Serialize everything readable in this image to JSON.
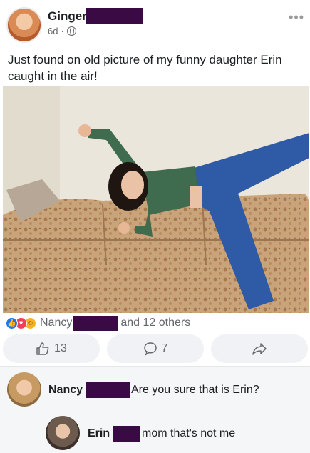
{
  "post": {
    "author_name": "Ginger",
    "time": "6d",
    "separator": "·",
    "more_label": "•••",
    "text": "Just found on old picture of my funny daughter Erin caught in the air!"
  },
  "reactions": {
    "names": "Nancy",
    "others": "and 12 others"
  },
  "actions": {
    "like_count": "13",
    "comment_count": "7"
  },
  "comments": [
    {
      "author": "Nancy",
      "text": "Are you sure that is Erin?"
    },
    {
      "author": "Erin",
      "text": "mom that's not me"
    }
  ],
  "colors": {
    "redaction": "#3a0a44",
    "like_blue": "#1877f2",
    "love_red": "#f33e58",
    "haha_yellow": "#f7b125"
  }
}
